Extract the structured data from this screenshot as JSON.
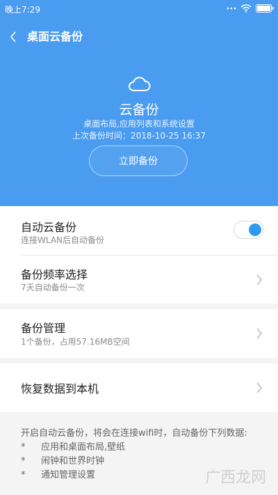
{
  "status_bar": {
    "time": "晚上7:29"
  },
  "header": {
    "title": "桌面云备份"
  },
  "hero": {
    "title": "云备份",
    "subtitle": "桌面布局,应用列表和系统设置",
    "last_backup": "上次备份时间：2018-10-25 16:37",
    "backup_button": "立即备份"
  },
  "settings": {
    "auto_backup": {
      "title": "自动云备份",
      "subtitle": "连接WLAN后自动备份",
      "enabled": true
    },
    "frequency": {
      "title": "备份频率选择",
      "subtitle": "7天自动备份一次"
    },
    "manage": {
      "title": "备份管理",
      "subtitle": "1个备份，占用57.16MB空间"
    },
    "restore": {
      "title": "恢复数据到本机"
    }
  },
  "info": {
    "intro": "开启自动云备份，将会在连接wifi时，自动备份下列数据:",
    "bullet": "*",
    "items": [
      "应用和桌面布局,壁纸",
      "闹钟和世界时钟",
      "通知管理设置"
    ]
  },
  "watermark": "广西龙网",
  "colors": {
    "accent": "#4a9cf0",
    "toggle_on": "#2f9af0"
  },
  "icons": [
    "back-icon",
    "cloud-icon",
    "chevron-right-icon",
    "wifi-icon",
    "battery-icon"
  ]
}
